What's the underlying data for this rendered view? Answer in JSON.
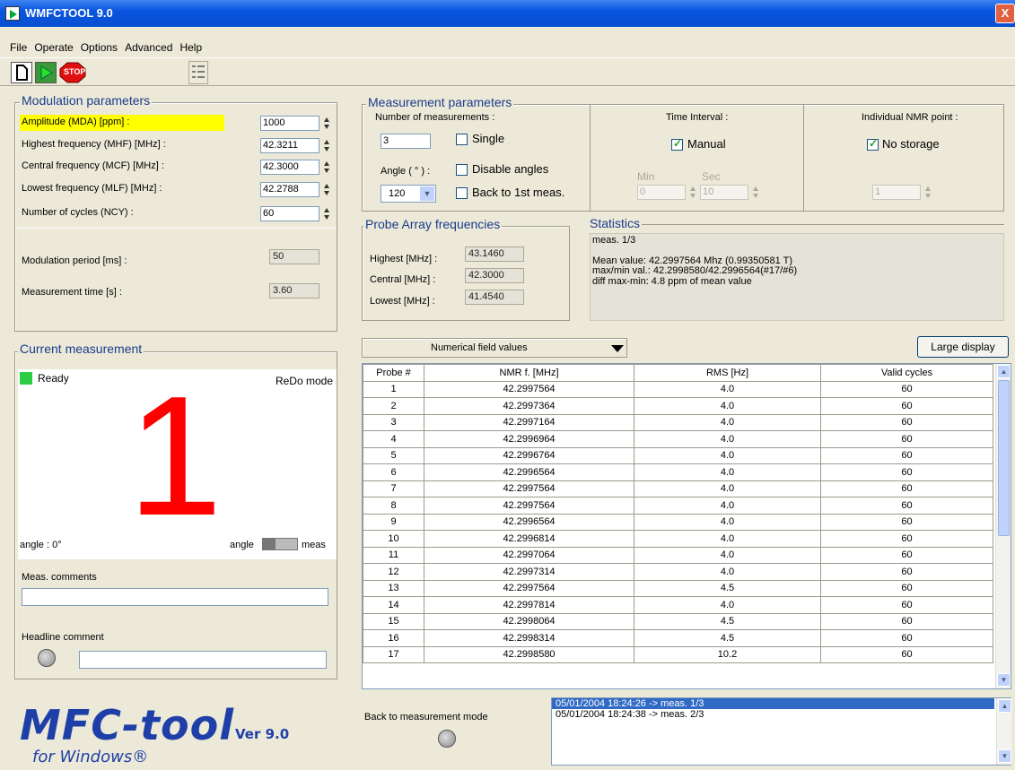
{
  "window": {
    "title": "WMFCTOOL 9.0",
    "close": "X"
  },
  "menu": [
    "File",
    "Operate",
    "Options",
    "Advanced",
    "Help"
  ],
  "toolbar": {
    "stop_label": "STOP"
  },
  "modulation": {
    "title": "Modulation parameters",
    "amplitude_label": "Amplitude (MDA) [ppm] :",
    "amplitude": "1000",
    "mhf_label": "Highest frequency (MHF) [MHz] :",
    "mhf": "42.3211",
    "mcf_label": "Central frequency (MCF) [MHz] :",
    "mcf": "42.3000",
    "mlf_label": "Lowest frequency (MLF) [MHz] :",
    "mlf": "42.2788",
    "ncy_label": "Number of cycles (NCY) :",
    "ncy": "60",
    "period_label": "Modulation period [ms] :",
    "period": "50",
    "time_label": "Measurement time [s] :",
    "time": "3.60"
  },
  "measurement_params": {
    "title": "Measurement parameters",
    "num_label": "Number of measurements :",
    "num": "3",
    "single_label": "Single",
    "angle_label": "Angle ( ° ) :",
    "angle": "120",
    "disable_angles_label": "Disable angles",
    "back_first_label": "Back to 1st meas.",
    "time_interval_label": "Time Interval :",
    "manual_label": "Manual",
    "min_label": "Min",
    "min": "0",
    "sec_label": "Sec",
    "sec": "10",
    "nmr_point_label": "Individual NMR point :",
    "no_storage_label": "No storage",
    "nmr_point": "1"
  },
  "probe_array": {
    "title": "Probe Array frequencies",
    "highest_label": "Highest [MHz] :",
    "highest": "43.1460",
    "central_label": "Central [MHz] :",
    "central": "42.3000",
    "lowest_label": "Lowest [MHz] :",
    "lowest": "41.4540"
  },
  "statistics": {
    "title": "Statistics",
    "lines": [
      "meas. 1/3",
      "",
      "Mean value: 42.2997564 Mhz (0.99350581 T)",
      "max/min val.: 42.2998580/42.2996564(#17/#6)",
      "diff max-min: 4.8 ppm of mean value"
    ]
  },
  "current": {
    "title": "Current measurement",
    "status": "Ready",
    "mode": "ReDo mode",
    "number": "1",
    "angle_text": "angle : 0°",
    "switch_left": "angle",
    "switch_right": "meas",
    "comments_label": "Meas. comments",
    "headline_label": "Headline comment"
  },
  "view": {
    "dropdown": "Numerical field values",
    "large_display": "Large display"
  },
  "table": {
    "headers": [
      "Probe #",
      "NMR f. [MHz]",
      "RMS [Hz]",
      "Valid cycles"
    ],
    "rows": [
      [
        "1",
        "42.2997564",
        "4.0",
        "60"
      ],
      [
        "2",
        "42.2997364",
        "4.0",
        "60"
      ],
      [
        "3",
        "42.2997164",
        "4.0",
        "60"
      ],
      [
        "4",
        "42.2996964",
        "4.0",
        "60"
      ],
      [
        "5",
        "42.2996764",
        "4.0",
        "60"
      ],
      [
        "6",
        "42.2996564",
        "4.0",
        "60"
      ],
      [
        "7",
        "42.2997564",
        "4.0",
        "60"
      ],
      [
        "8",
        "42.2997564",
        "4.0",
        "60"
      ],
      [
        "9",
        "42.2996564",
        "4.0",
        "60"
      ],
      [
        "10",
        "42.2996814",
        "4.0",
        "60"
      ],
      [
        "11",
        "42.2997064",
        "4.0",
        "60"
      ],
      [
        "12",
        "42.2997314",
        "4.0",
        "60"
      ],
      [
        "13",
        "42.2997564",
        "4.5",
        "60"
      ],
      [
        "14",
        "42.2997814",
        "4.0",
        "60"
      ],
      [
        "15",
        "42.2998064",
        "4.5",
        "60"
      ],
      [
        "16",
        "42.2998314",
        "4.5",
        "60"
      ],
      [
        "17",
        "42.2998580",
        "10.2",
        "60"
      ]
    ]
  },
  "log": {
    "back_label": "Back to measurement mode",
    "entries": [
      "05/01/2004  18:24:26 -> meas. 1/3",
      "05/01/2004  18:24:38 -> meas. 2/3"
    ]
  },
  "logo": {
    "main": "MFC-tool",
    "version": "Ver 9.0",
    "sub": "for Windows®"
  },
  "colors": {
    "highlight": "#ffff00",
    "big_number": "#ff0000",
    "panel_title": "#1a3c8c",
    "selection": "#316ac5"
  }
}
